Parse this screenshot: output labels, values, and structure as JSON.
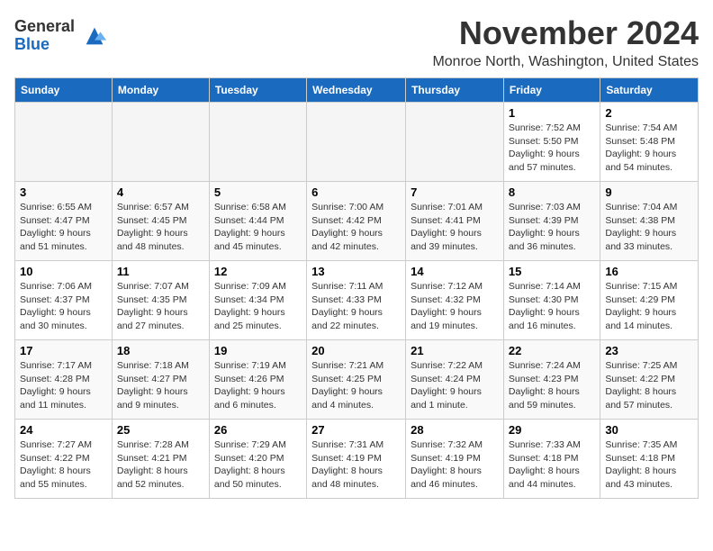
{
  "logo": {
    "text_general": "General",
    "text_blue": "Blue"
  },
  "header": {
    "month_year": "November 2024",
    "location": "Monroe North, Washington, United States"
  },
  "days_of_week": [
    "Sunday",
    "Monday",
    "Tuesday",
    "Wednesday",
    "Thursday",
    "Friday",
    "Saturday"
  ],
  "weeks": [
    [
      {
        "day": "",
        "info": ""
      },
      {
        "day": "",
        "info": ""
      },
      {
        "day": "",
        "info": ""
      },
      {
        "day": "",
        "info": ""
      },
      {
        "day": "",
        "info": ""
      },
      {
        "day": "1",
        "info": "Sunrise: 7:52 AM\nSunset: 5:50 PM\nDaylight: 9 hours and 57 minutes."
      },
      {
        "day": "2",
        "info": "Sunrise: 7:54 AM\nSunset: 5:48 PM\nDaylight: 9 hours and 54 minutes."
      }
    ],
    [
      {
        "day": "3",
        "info": "Sunrise: 6:55 AM\nSunset: 4:47 PM\nDaylight: 9 hours and 51 minutes."
      },
      {
        "day": "4",
        "info": "Sunrise: 6:57 AM\nSunset: 4:45 PM\nDaylight: 9 hours and 48 minutes."
      },
      {
        "day": "5",
        "info": "Sunrise: 6:58 AM\nSunset: 4:44 PM\nDaylight: 9 hours and 45 minutes."
      },
      {
        "day": "6",
        "info": "Sunrise: 7:00 AM\nSunset: 4:42 PM\nDaylight: 9 hours and 42 minutes."
      },
      {
        "day": "7",
        "info": "Sunrise: 7:01 AM\nSunset: 4:41 PM\nDaylight: 9 hours and 39 minutes."
      },
      {
        "day": "8",
        "info": "Sunrise: 7:03 AM\nSunset: 4:39 PM\nDaylight: 9 hours and 36 minutes."
      },
      {
        "day": "9",
        "info": "Sunrise: 7:04 AM\nSunset: 4:38 PM\nDaylight: 9 hours and 33 minutes."
      }
    ],
    [
      {
        "day": "10",
        "info": "Sunrise: 7:06 AM\nSunset: 4:37 PM\nDaylight: 9 hours and 30 minutes."
      },
      {
        "day": "11",
        "info": "Sunrise: 7:07 AM\nSunset: 4:35 PM\nDaylight: 9 hours and 27 minutes."
      },
      {
        "day": "12",
        "info": "Sunrise: 7:09 AM\nSunset: 4:34 PM\nDaylight: 9 hours and 25 minutes."
      },
      {
        "day": "13",
        "info": "Sunrise: 7:11 AM\nSunset: 4:33 PM\nDaylight: 9 hours and 22 minutes."
      },
      {
        "day": "14",
        "info": "Sunrise: 7:12 AM\nSunset: 4:32 PM\nDaylight: 9 hours and 19 minutes."
      },
      {
        "day": "15",
        "info": "Sunrise: 7:14 AM\nSunset: 4:30 PM\nDaylight: 9 hours and 16 minutes."
      },
      {
        "day": "16",
        "info": "Sunrise: 7:15 AM\nSunset: 4:29 PM\nDaylight: 9 hours and 14 minutes."
      }
    ],
    [
      {
        "day": "17",
        "info": "Sunrise: 7:17 AM\nSunset: 4:28 PM\nDaylight: 9 hours and 11 minutes."
      },
      {
        "day": "18",
        "info": "Sunrise: 7:18 AM\nSunset: 4:27 PM\nDaylight: 9 hours and 9 minutes."
      },
      {
        "day": "19",
        "info": "Sunrise: 7:19 AM\nSunset: 4:26 PM\nDaylight: 9 hours and 6 minutes."
      },
      {
        "day": "20",
        "info": "Sunrise: 7:21 AM\nSunset: 4:25 PM\nDaylight: 9 hours and 4 minutes."
      },
      {
        "day": "21",
        "info": "Sunrise: 7:22 AM\nSunset: 4:24 PM\nDaylight: 9 hours and 1 minute."
      },
      {
        "day": "22",
        "info": "Sunrise: 7:24 AM\nSunset: 4:23 PM\nDaylight: 8 hours and 59 minutes."
      },
      {
        "day": "23",
        "info": "Sunrise: 7:25 AM\nSunset: 4:22 PM\nDaylight: 8 hours and 57 minutes."
      }
    ],
    [
      {
        "day": "24",
        "info": "Sunrise: 7:27 AM\nSunset: 4:22 PM\nDaylight: 8 hours and 55 minutes."
      },
      {
        "day": "25",
        "info": "Sunrise: 7:28 AM\nSunset: 4:21 PM\nDaylight: 8 hours and 52 minutes."
      },
      {
        "day": "26",
        "info": "Sunrise: 7:29 AM\nSunset: 4:20 PM\nDaylight: 8 hours and 50 minutes."
      },
      {
        "day": "27",
        "info": "Sunrise: 7:31 AM\nSunset: 4:19 PM\nDaylight: 8 hours and 48 minutes."
      },
      {
        "day": "28",
        "info": "Sunrise: 7:32 AM\nSunset: 4:19 PM\nDaylight: 8 hours and 46 minutes."
      },
      {
        "day": "29",
        "info": "Sunrise: 7:33 AM\nSunset: 4:18 PM\nDaylight: 8 hours and 44 minutes."
      },
      {
        "day": "30",
        "info": "Sunrise: 7:35 AM\nSunset: 4:18 PM\nDaylight: 8 hours and 43 minutes."
      }
    ]
  ]
}
